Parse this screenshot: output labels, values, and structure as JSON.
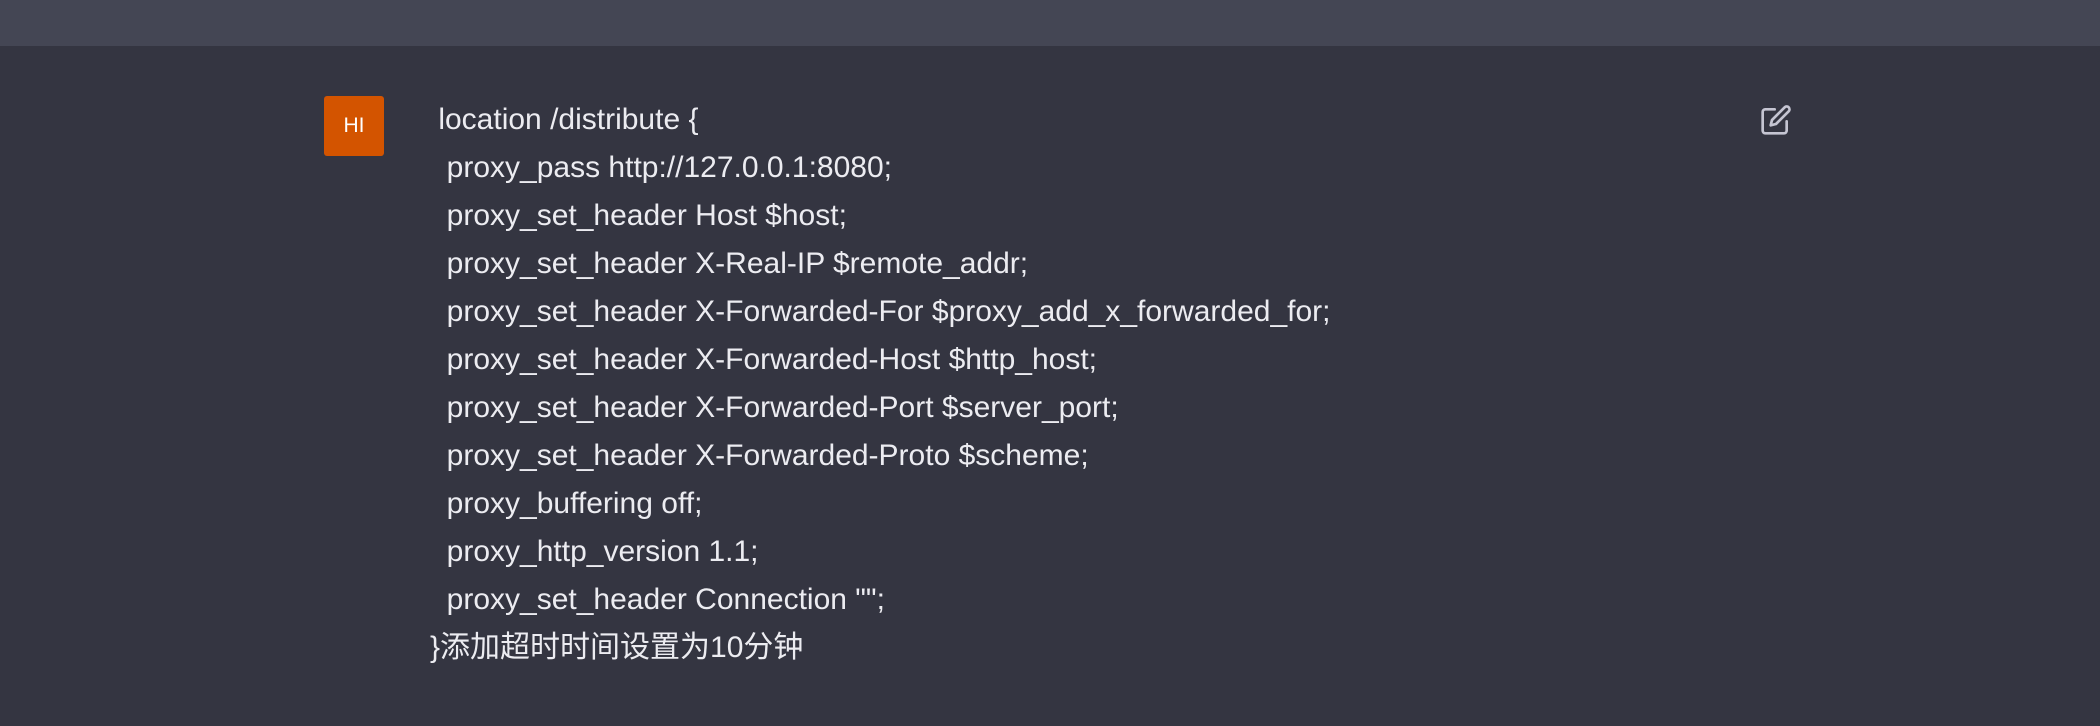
{
  "user": {
    "avatar_initials": "HI",
    "avatar_color": "#d35400"
  },
  "message": {
    "lines": [
      " location /distribute {",
      "  proxy_pass http://127.0.0.1:8080;",
      "  proxy_set_header Host $host;",
      "  proxy_set_header X-Real-IP $remote_addr;",
      "  proxy_set_header X-Forwarded-For $proxy_add_x_forwarded_for;",
      "  proxy_set_header X-Forwarded-Host $http_host;",
      "  proxy_set_header X-Forwarded-Port $server_port;",
      "  proxy_set_header X-Forwarded-Proto $scheme;",
      "  proxy_buffering off;",
      "  proxy_http_version 1.1;",
      "  proxy_set_header Connection \"\";",
      "}添加超时时间设置为10分钟"
    ]
  },
  "actions": {
    "edit_icon": "edit-icon"
  },
  "colors": {
    "background": "#343541",
    "top_bar": "#444654",
    "text": "#ececf1",
    "icon": "#c5c5d2"
  }
}
